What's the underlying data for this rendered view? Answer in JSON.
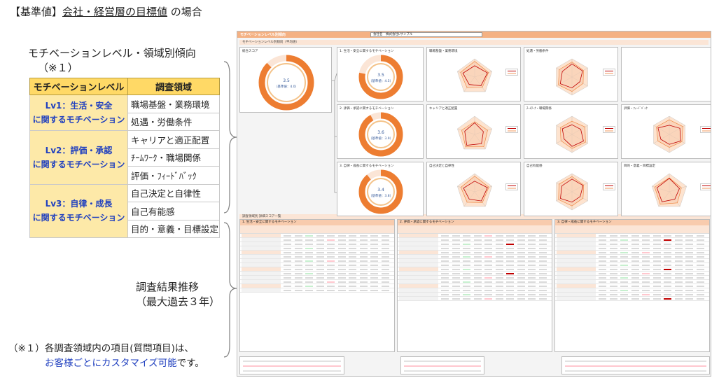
{
  "title": {
    "prefix": "【基準値】",
    "underlined": "会社・経営層の目標値",
    "suffix": " の場合"
  },
  "section1": {
    "title": "モチベーションレベル・領域別傾向",
    "note": "（※１）"
  },
  "table": {
    "header_level": "モチベーションレベル",
    "header_domain": "調査領域",
    "rows": [
      {
        "level_line1": "Lv1：生活・安全",
        "level_line2": "に関するモチベーション",
        "domains": [
          "職場基盤・業務環境",
          "処遇・労働条件"
        ]
      },
      {
        "level_line1": "Lv2：評価・承認",
        "level_line2": "に関するモチベーション",
        "domains": [
          "キャリアと適正配置",
          "ﾁｰﾑﾜｰｸ・職場関係",
          "評価・ﾌｨｰﾄﾞﾊﾞｯｸ"
        ]
      },
      {
        "level_line1": "Lv3：自律・成長",
        "level_line2": "に関するモチベーション",
        "domains": [
          "自己決定と自律性",
          "自己有能感",
          "目的・意義・目標設定"
        ]
      }
    ]
  },
  "section2": {
    "title": "調査結果推移",
    "note": "（最大過去３年）"
  },
  "footnote": {
    "line1": "（※１）各調査領域内の項目(質問項目)は、",
    "line2_blue": "お客様ごとにカスタマイズ可能",
    "line2_rest": "です。"
  },
  "report": {
    "header_title": "モチベーションレベル別傾向",
    "company_label": "会社名",
    "company_name": "株式会社Lサンプル",
    "sub_title": "モチベーションレベル別傾向（平均値）",
    "donuts": [
      {
        "label": "総合スコア",
        "score": "3.5",
        "base": "（基準値：4.0）",
        "fraction": 0.875
      },
      {
        "label": "1. 生活・安全に関するモチベーション",
        "score": "3.5",
        "base": "（基準値：4.5）",
        "fraction": 0.78
      },
      {
        "label": "2. 評価・承認に関するモチベーション",
        "score": "3.6",
        "base": "（基準値：3.9）",
        "fraction": 0.92
      },
      {
        "label": "3. 自律・成長に関するモチベーション",
        "score": "3.4",
        "base": "（基準値：3.8）",
        "fraction": 0.89
      }
    ],
    "radar_panels": [
      "職場基盤・業務環境",
      "処遇・労働条件",
      "",
      "キャリアと適正配置",
      "ﾁｰﾑﾜｰｸ・職場関係",
      "評価・ﾌｨｰﾄﾞﾊﾞｯｸ",
      "自己決定と自律性",
      "自己有能感",
      "目的・意義・目標設定"
    ],
    "table_section_title": "調査領域別 詳細スコア一覧",
    "table_titles": [
      "1. 生活・安全に関するモチベーション",
      "2. 評価・承認に関するモチベーション",
      "3. 自律・成長に関するモチベーション"
    ],
    "colors": {
      "orange": "#ed7d31",
      "light_orange": "#fbe5d6",
      "peach": "#f8cbad",
      "level_bg": "#fde9a8",
      "header_yellow": "#ffd966",
      "blue_text": "#1f3fbf"
    }
  }
}
